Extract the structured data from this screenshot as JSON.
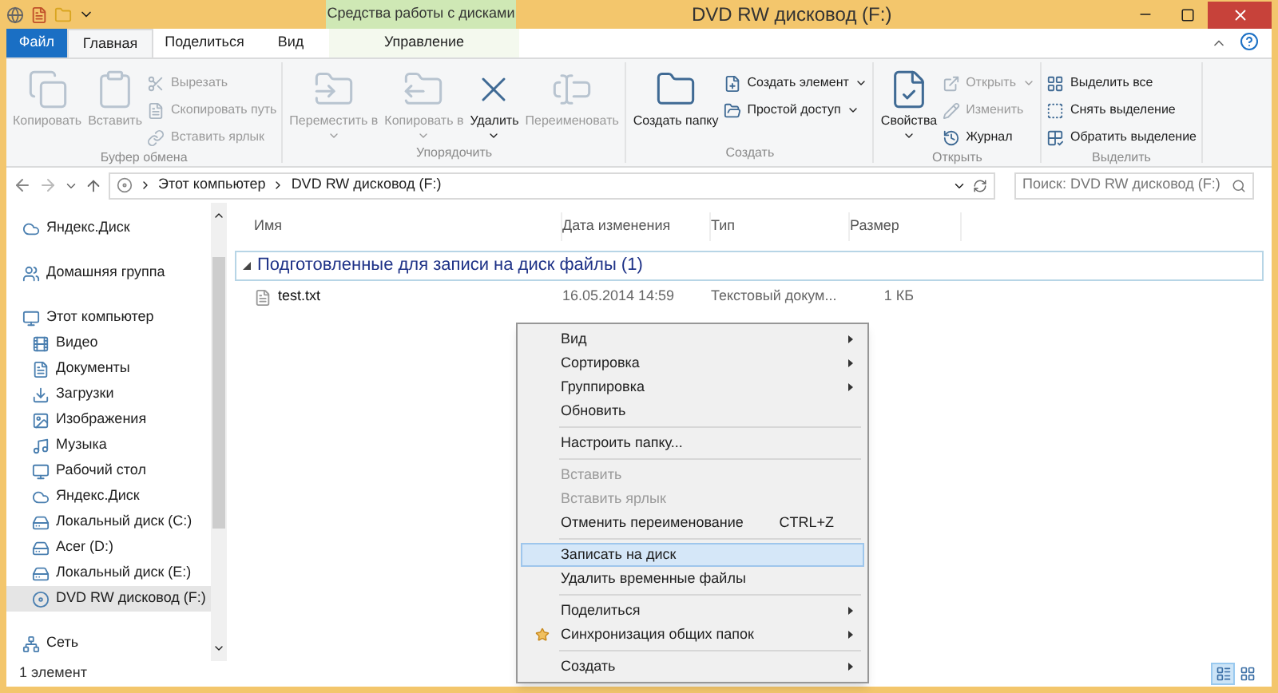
{
  "window": {
    "title": "DVD RW дисковод (F:)"
  },
  "contextual_tab_group": {
    "label": "Средства работы с дисками"
  },
  "tabs": [
    {
      "label": "Файл",
      "kind": "file",
      "selected": false
    },
    {
      "label": "Главная",
      "kind": "tab",
      "selected": true
    },
    {
      "label": "Поделиться",
      "kind": "tab",
      "selected": false
    },
    {
      "label": "Вид",
      "kind": "tab",
      "selected": false
    },
    {
      "label": "Управление",
      "kind": "contextual",
      "selected": false
    }
  ],
  "ribbon": {
    "groups": [
      {
        "label": "Буфер обмена",
        "large": [
          {
            "label": "Копировать",
            "disabled": true,
            "dropdown": false
          },
          {
            "label": "Вставить",
            "disabled": true,
            "dropdown": false
          }
        ],
        "small": [
          {
            "label": "Вырезать",
            "disabled": true,
            "dropdown": false
          },
          {
            "label": "Скопировать путь",
            "disabled": true,
            "dropdown": false
          },
          {
            "label": "Вставить ярлык",
            "disabled": true,
            "dropdown": false
          }
        ]
      },
      {
        "label": "Упорядочить",
        "large": [
          {
            "label": "Переместить в",
            "disabled": true,
            "dropdown": true
          },
          {
            "label": "Копировать в",
            "disabled": true,
            "dropdown": true
          },
          {
            "label": "Удалить",
            "disabled": false,
            "dropdown": true
          },
          {
            "label": "Переименовать",
            "disabled": true,
            "dropdown": false
          }
        ]
      },
      {
        "label": "Создать",
        "large": [
          {
            "label": "Создать папку",
            "disabled": false,
            "dropdown": false
          }
        ],
        "small": [
          {
            "label": "Создать элемент",
            "disabled": false,
            "dropdown": true
          },
          {
            "label": "Простой доступ",
            "disabled": false,
            "dropdown": true
          }
        ]
      },
      {
        "label": "Открыть",
        "large": [
          {
            "label": "Свойства",
            "disabled": false,
            "dropdown": true
          }
        ],
        "small": [
          {
            "label": "Открыть",
            "disabled": true,
            "dropdown": true
          },
          {
            "label": "Изменить",
            "disabled": true,
            "dropdown": false
          },
          {
            "label": "Журнал",
            "disabled": false,
            "dropdown": false
          }
        ]
      },
      {
        "label": "Выделить",
        "small": [
          {
            "label": "Выделить все",
            "disabled": false,
            "dropdown": false
          },
          {
            "label": "Снять выделение",
            "disabled": false,
            "dropdown": false
          },
          {
            "label": "Обратить выделение",
            "disabled": false,
            "dropdown": false
          }
        ]
      }
    ]
  },
  "address_bar": {
    "breadcrumbs": [
      "Этот компьютер",
      "DVD RW дисковод (F:)"
    ]
  },
  "search": {
    "placeholder": "Поиск: DVD RW дисковод (F:)"
  },
  "sidebar": {
    "items": [
      {
        "label": "Яндекс.Диск",
        "selected": false
      },
      {
        "label": "Домашняя группа",
        "selected": false
      },
      {
        "label": "Этот компьютер",
        "selected": false,
        "children": [
          {
            "label": "Видео",
            "selected": false
          },
          {
            "label": "Документы",
            "selected": false
          },
          {
            "label": "Загрузки",
            "selected": false
          },
          {
            "label": "Изображения",
            "selected": false
          },
          {
            "label": "Музыка",
            "selected": false
          },
          {
            "label": "Рабочий стол",
            "selected": false
          },
          {
            "label": "Яндекс.Диск",
            "selected": false
          },
          {
            "label": "Локальный диск (C:)",
            "selected": false
          },
          {
            "label": "Acer (D:)",
            "selected": false
          },
          {
            "label": "Локальный диск (E:)",
            "selected": false
          },
          {
            "label": "DVD RW дисковод (F:)",
            "selected": true
          }
        ]
      },
      {
        "label": "Сеть",
        "selected": false
      }
    ]
  },
  "table": {
    "columns": [
      "Имя",
      "Дата изменения",
      "Тип",
      "Размер"
    ],
    "groups": [
      {
        "label": "Подготовленные для записи на диск файлы (1)",
        "expanded": true,
        "rows": [
          [
            "test.txt",
            "16.05.2014 14:59",
            "Текстовый докум...",
            "1 КБ"
          ]
        ]
      }
    ]
  },
  "context_menu": {
    "items": [
      {
        "kind": "item",
        "label": "Вид",
        "disabled": false,
        "selected": false,
        "submenu": true
      },
      {
        "kind": "item",
        "label": "Сортировка",
        "disabled": false,
        "selected": false,
        "submenu": true
      },
      {
        "kind": "item",
        "label": "Группировка",
        "disabled": false,
        "selected": false,
        "submenu": true
      },
      {
        "kind": "item",
        "label": "Обновить",
        "disabled": false,
        "selected": false,
        "submenu": false
      },
      {
        "kind": "separator"
      },
      {
        "kind": "item",
        "label": "Настроить папку...",
        "disabled": false,
        "selected": false,
        "submenu": false
      },
      {
        "kind": "separator"
      },
      {
        "kind": "item",
        "label": "Вставить",
        "disabled": true,
        "selected": false,
        "submenu": false
      },
      {
        "kind": "item",
        "label": "Вставить ярлык",
        "disabled": true,
        "selected": false,
        "submenu": false
      },
      {
        "kind": "item",
        "label": "Отменить переименование",
        "shortcut": "CTRL+Z",
        "disabled": false,
        "selected": false,
        "submenu": false
      },
      {
        "kind": "separator"
      },
      {
        "kind": "item",
        "label": "Записать на диск",
        "disabled": false,
        "selected": true,
        "submenu": false
      },
      {
        "kind": "item",
        "label": "Удалить временные файлы",
        "disabled": false,
        "selected": false,
        "submenu": false
      },
      {
        "kind": "separator"
      },
      {
        "kind": "item",
        "label": "Поделиться",
        "disabled": false,
        "selected": false,
        "submenu": true
      },
      {
        "kind": "item",
        "label": "Синхронизация общих папок",
        "disabled": false,
        "selected": false,
        "submenu": true,
        "icon": true
      },
      {
        "kind": "separator"
      },
      {
        "kind": "item",
        "label": "Создать",
        "disabled": false,
        "selected": false,
        "submenu": true
      }
    ]
  },
  "status_bar": {
    "text": "1 элемент",
    "views": [
      {
        "selected": true
      },
      {
        "selected": false
      }
    ]
  }
}
